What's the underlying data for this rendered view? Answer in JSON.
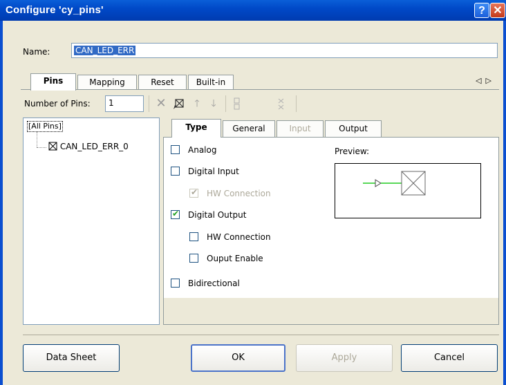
{
  "window": {
    "title": "Configure 'cy_pins'",
    "help_glyph": "?",
    "close_glyph": "✕"
  },
  "name": {
    "label": "Name:",
    "value": "CAN_LED_ERR"
  },
  "tabs": [
    {
      "label": "Pins",
      "active": true
    },
    {
      "label": "Mapping"
    },
    {
      "label": "Reset"
    },
    {
      "label": "Built-in"
    }
  ],
  "tab_scroll": {
    "left": "◁",
    "right": "▷"
  },
  "toolbar": {
    "number_of_pins_label": "Number of Pins:",
    "number_of_pins_value": "1",
    "icons": [
      "delete-icon",
      "pin-edit-icon",
      "move-up-icon",
      "move-down-icon",
      "group-icon",
      "ungroup-icon"
    ]
  },
  "tree": {
    "root": "[All Pins]",
    "child": "CAN_LED_ERR_0"
  },
  "inner_tabs": [
    {
      "label": "Type",
      "active": true
    },
    {
      "label": "General"
    },
    {
      "label": "Input",
      "disabled": true
    },
    {
      "label": "Output"
    }
  ],
  "type_options": {
    "analog": {
      "label": "Analog",
      "checked": false
    },
    "digital_input": {
      "label": "Digital Input",
      "checked": false
    },
    "di_hw_connection": {
      "label": "HW Connection",
      "checked": true,
      "disabled": true
    },
    "digital_output": {
      "label": "Digital Output",
      "checked": true
    },
    "do_hw_connection": {
      "label": "HW Connection",
      "checked": false
    },
    "output_enable": {
      "label": "Ouput Enable",
      "checked": false
    },
    "bidirectional": {
      "label": "Bidirectional",
      "checked": false
    }
  },
  "preview": {
    "label": "Preview:"
  },
  "colors": {
    "accent": "#316ac5",
    "title_bar": "#0049c8",
    "check": "#21a121",
    "wire": "#22cc22"
  },
  "buttons": {
    "data_sheet": "Data Sheet",
    "ok": "OK",
    "apply": "Apply",
    "cancel": "Cancel"
  }
}
